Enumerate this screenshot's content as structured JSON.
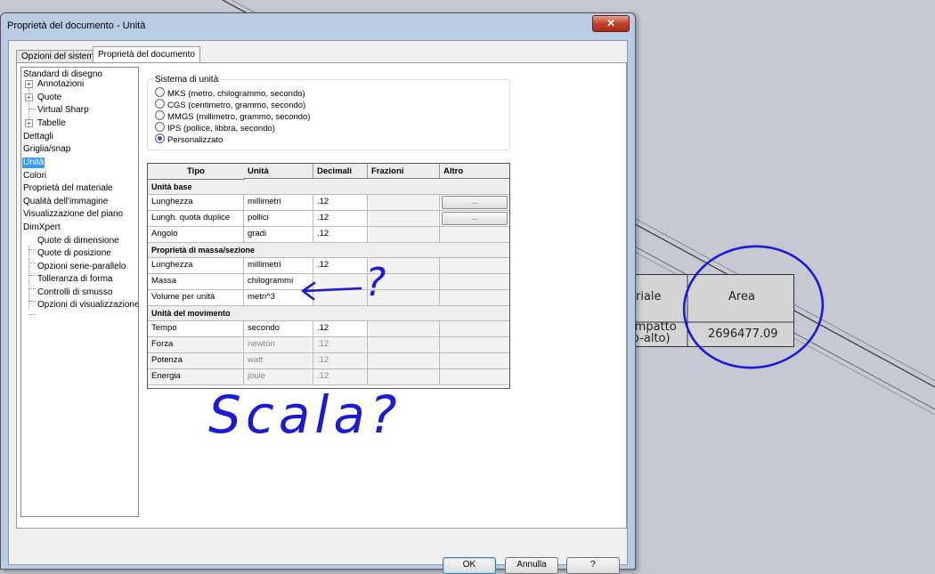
{
  "dialog": {
    "title": "Proprietà del documento - Unità",
    "close_icon": "x-icon",
    "tabs": [
      {
        "label": "Opzioni del sistema"
      },
      {
        "label": "Proprietà del documento"
      }
    ]
  },
  "tree": {
    "items": [
      {
        "label": "Standard di disegno"
      },
      {
        "label": "Annotazioni"
      },
      {
        "label": "Quote"
      },
      {
        "label": "Virtual Sharp"
      },
      {
        "label": "Tabelle"
      },
      {
        "label": "Dettagli"
      },
      {
        "label": "Griglia/snap"
      },
      {
        "label": "Unità"
      },
      {
        "label": "Colori"
      },
      {
        "label": "Proprietà del materiale"
      },
      {
        "label": "Qualità dell'immagine"
      },
      {
        "label": "Visualizzazione del piano"
      },
      {
        "label": "DimXpert"
      },
      {
        "label": "Quote di dimensione"
      },
      {
        "label": "Quote di posizione"
      },
      {
        "label": "Opzioni serie-parallelo"
      },
      {
        "label": "Tolleranza di forma"
      },
      {
        "label": "Controlli di smusso"
      },
      {
        "label": "Opzioni di visualizzazione"
      }
    ]
  },
  "unit_system": {
    "legend": "Sistema di unità",
    "options": [
      {
        "label": "MKS  (metro, chilogrammo, secondo)"
      },
      {
        "label": "CGS  (centimetro, grammo, secondo)"
      },
      {
        "label": "MMGS (millimetro, grammo, secondo)"
      },
      {
        "label": "IPS  (pollice, libbra, secondo)"
      },
      {
        "label": "Personalizzato"
      }
    ],
    "selected": "Personalizzato"
  },
  "grid": {
    "headers": [
      "Tipo",
      "Unità",
      "Decimali",
      "Frazioni",
      "Altro"
    ],
    "sections": [
      {
        "title": "Unità base",
        "rows": [
          {
            "tipo": "Lunghezza",
            "unita": "millimetri",
            "decimali": ".12",
            "altro": "..."
          },
          {
            "tipo": "Lungh. quota duplice",
            "unita": "pollici",
            "decimali": ".12",
            "altro": "..."
          },
          {
            "tipo": "Angolo",
            "unita": "gradi",
            "decimali": ".12",
            "altro": ""
          }
        ]
      },
      {
        "title": "Proprietà di massa/sezione",
        "rows": [
          {
            "tipo": "Lunghezza",
            "unita": "millimetri",
            "decimali": ".12"
          },
          {
            "tipo": "Massa",
            "unita": "chilogrammi",
            "decimali": ""
          },
          {
            "tipo": "Volume per unità",
            "unita": "metri^3",
            "decimali": ""
          }
        ]
      },
      {
        "title": "Unità del movimento",
        "rows": [
          {
            "tipo": "Tempo",
            "unita": "secondo",
            "decimali": ".12"
          },
          {
            "tipo": "Forza",
            "unita": "newton",
            "decimali": ".12"
          },
          {
            "tipo": "Potenza",
            "unita": "watt",
            "decimali": ".12"
          },
          {
            "tipo": "Energia",
            "unita": "joule",
            "decimali": ".12"
          }
        ]
      }
    ]
  },
  "buttons": {
    "ok": "OK",
    "cancel": "Annulla",
    "help": "?"
  },
  "background_table": {
    "header_left": "eriale",
    "header_right": "Area",
    "value_left_line1": "(impatto",
    "value_left_line2": "o-alto)",
    "value_right": "2696477.09"
  },
  "annotations": {
    "question_mark": "?",
    "scala_text": "Scala?",
    "pen_color": "#1b1bd6"
  }
}
